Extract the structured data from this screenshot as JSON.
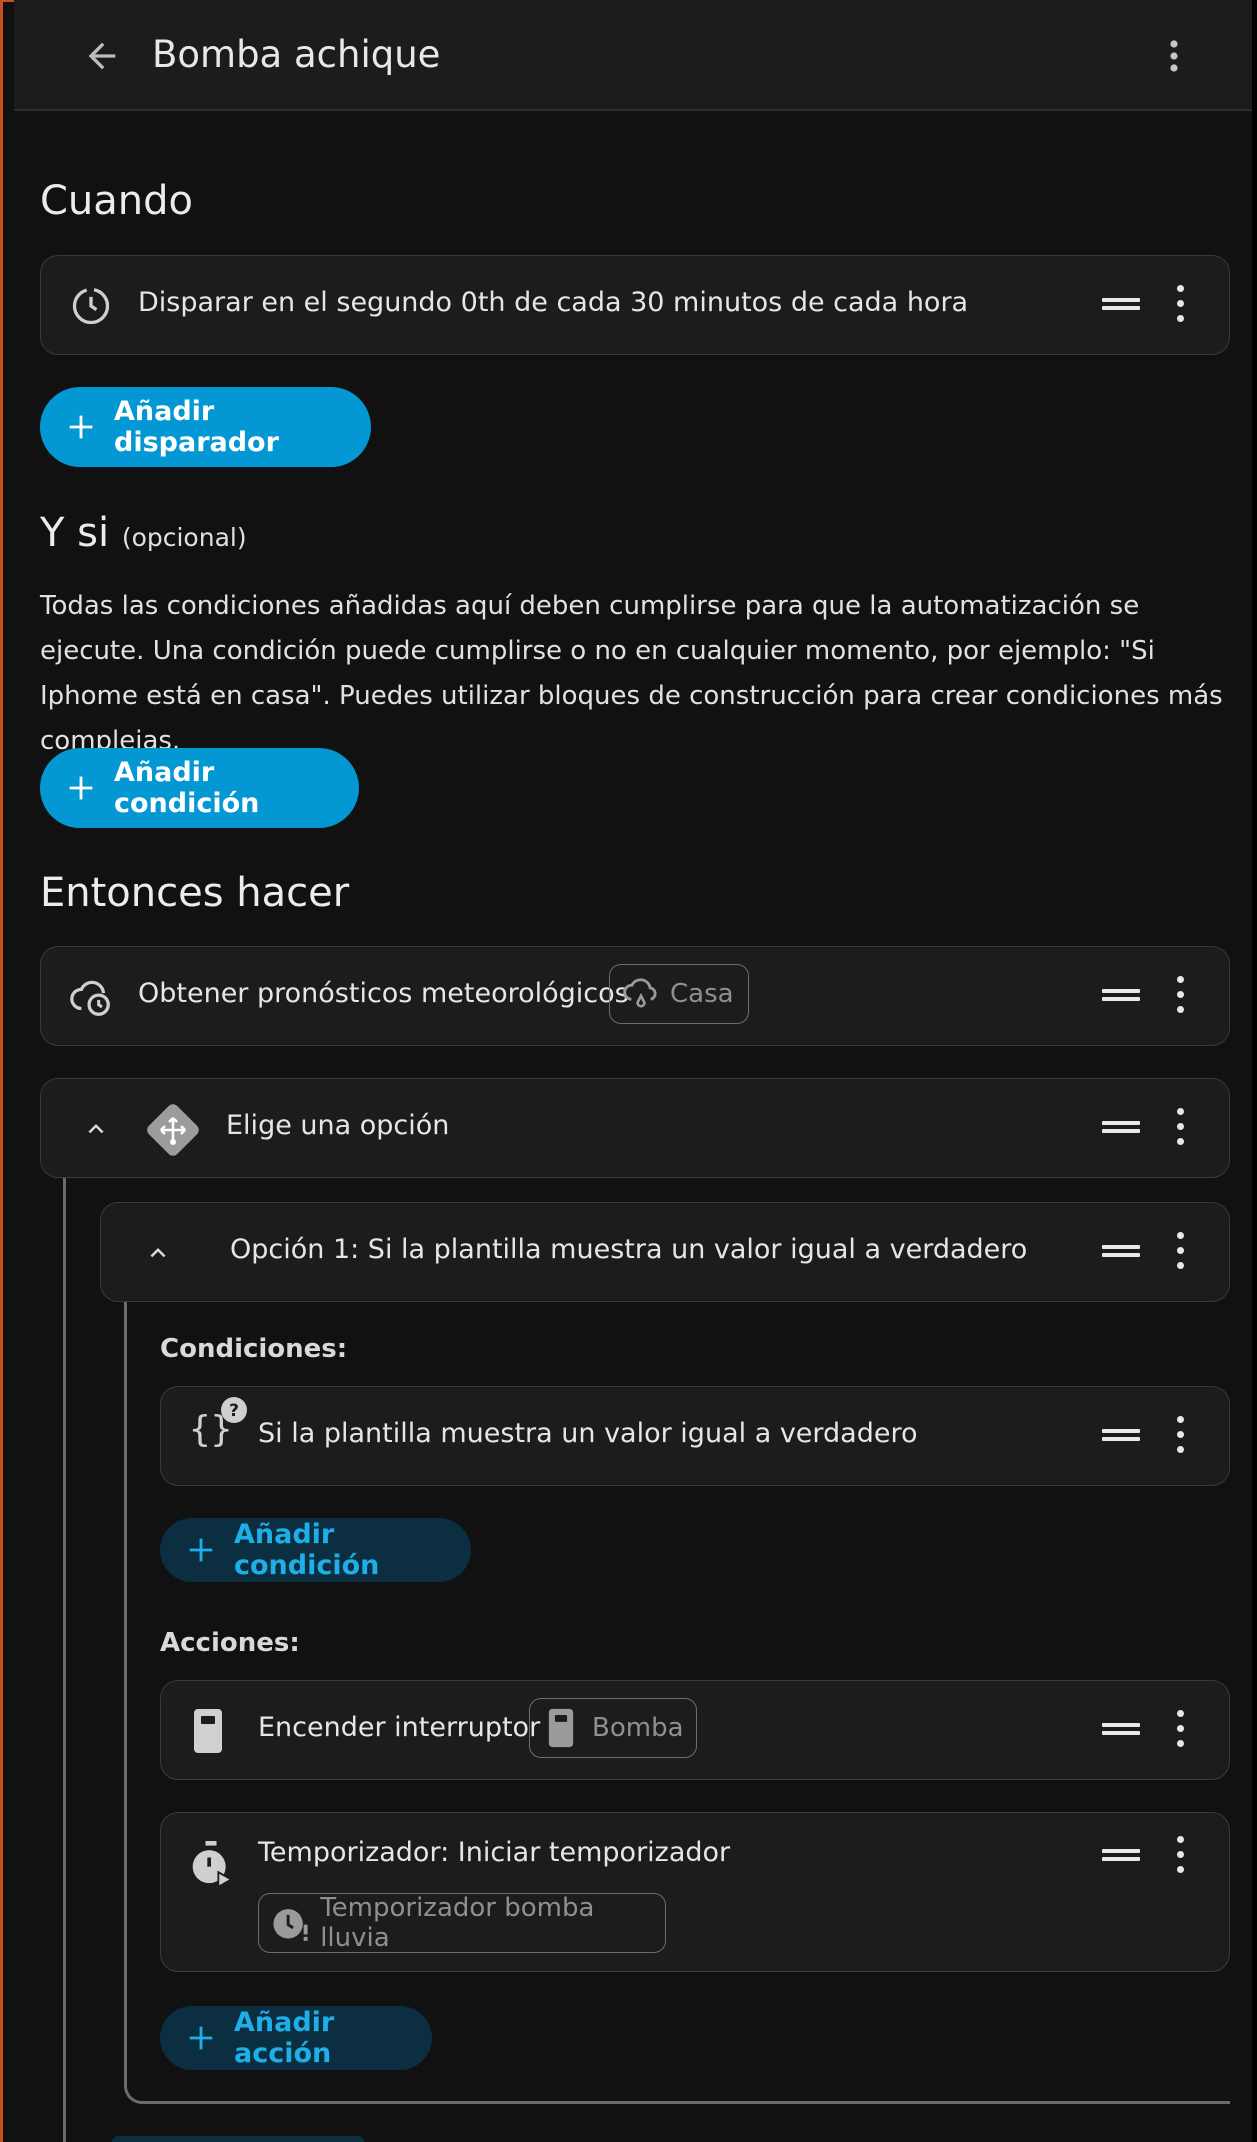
{
  "header": {
    "title": "Bomba achique"
  },
  "when": {
    "heading": "Cuando",
    "trigger_text": "Disparar en el segundo 0th de cada 30 minutos de cada hora",
    "add_trigger_label": "Añadir disparador"
  },
  "conditions": {
    "heading": "Y si",
    "optional": "(opcional)",
    "description": "Todas las condiciones añadidas aquí deben cumplirse para que la automatización se ejecute. Una condición puede cumplirse o no en cualquier momento, por ejemplo: \"Si Iphome está en casa\". Puedes utilizar bloques de construcción para crear condiciones más complejas.",
    "add_condition_label": "Añadir condición"
  },
  "actions": {
    "heading": "Entonces hacer",
    "weather_action": {
      "text": "Obtener pronósticos meteorológicos",
      "chip": "Casa"
    },
    "choose": {
      "text": "Elige una opción"
    },
    "option1": {
      "title": "Opción 1: Si la plantilla muestra un valor igual a verdadero",
      "conditions_label": "Condiciones:",
      "template_condition": "Si la plantilla muestra un valor igual a verdadero",
      "add_condition_label": "Añadir condición",
      "actions_label": "Acciones:",
      "switch_action": {
        "text": "Encender interruptor",
        "chip": "Bomba"
      },
      "timer_action": {
        "text": "Temporizador: Iniciar temporizador",
        "chip": "Temporizador bomba lluvia"
      },
      "add_action_label": "Añadir acción"
    }
  },
  "colors": {
    "accent": "#0398d4",
    "accent_dark_bg": "#0b2f41",
    "accent_dark_text": "#1eaee8",
    "frame": "#c7521f"
  }
}
